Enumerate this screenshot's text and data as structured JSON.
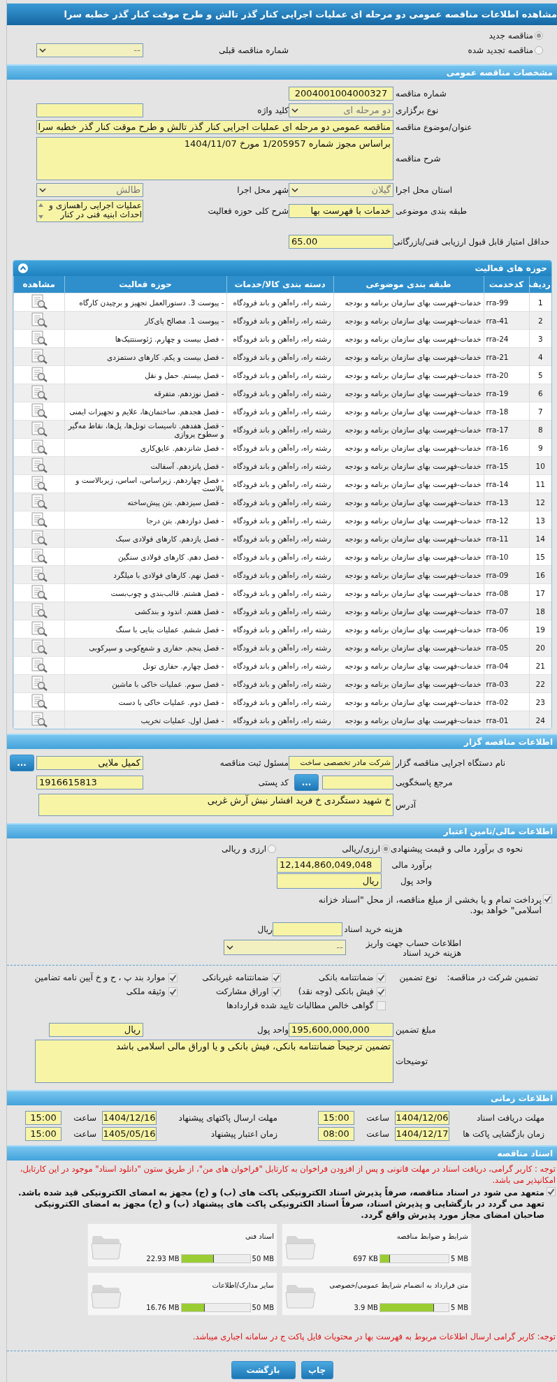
{
  "title": "مشاهده اطلاعات مناقصه عمومی دو مرحله ای عملیات اجرایی کنار گذر تالش و طرح موقت کنار گذر خطبه سرا",
  "tender_type": [
    {
      "label": "مناقصه جدید",
      "selected": true
    },
    {
      "label": "مناقصه تجدید شده",
      "selected": false
    }
  ],
  "previous_tender": {
    "label": "شماره مناقصه قبلی",
    "value": "--"
  },
  "general": {
    "header": "مشخصات مناقصه عمومی",
    "rows": [
      [
        {
          "label": "شماره مناقصه",
          "kind": "number",
          "value": "2004001004000327"
        }
      ],
      [
        {
          "label": "نوع برگزاری",
          "kind": "choice",
          "value": "دو مرحله ای"
        },
        {
          "label": "کلید واژه",
          "kind": "text"
        }
      ],
      [
        {
          "label": "عنوان/موضوع مناقصه",
          "kind": "line",
          "value": "مناقصه عمومی دو مرحله ای عملیات اجرایی کنار گذر تالش و طرح موقت کنار گذر خطبه سرا"
        }
      ],
      [
        {
          "label": "شرح مناقصه",
          "kind": "memo",
          "value": "براساس مجوز شماره 1/205957 مورخ 1404/11/07"
        }
      ],
      [
        {
          "label": "استان محل اجرا",
          "kind": "choice",
          "value": "گیلان"
        },
        {
          "label": "شهر محل اجرا",
          "kind": "choice",
          "value": "طالش"
        }
      ],
      [
        {
          "label": "طبقه بندی موضوعی",
          "kind": "text",
          "value": "خدمات با فهرست بها"
        },
        {
          "label": "شرح کلی حوزه فعالیت",
          "kind": "list",
          "lines": [
            "عملیات اجرایی راهسازی و",
            "احداث ابنیه فنی در  کنار"
          ]
        }
      ]
    ],
    "min_score": {
      "label": "حداقل امتیاز قابل قبول ارزیابی فنی/بازرگانی",
      "value": "65.00"
    }
  },
  "activities": {
    "header": "حوزه های فعالیت",
    "columns": [
      "ردیف",
      "کدخدمت",
      "طبقه بندی موضوعی",
      "دسته بندی کالا/خدمات",
      "حوزه فعالیت",
      "مشاهده"
    ],
    "rows": [
      [
        "1",
        "rra-99",
        "خدمات-فهرست بهای سازمان برنامه و بودجه",
        "رشته راه، راه‌آهن و باند فرودگاه",
        "- پیوست 3. دستورالعمل تجهیز و برچیدن کارگاه"
      ],
      [
        "2",
        "rra-41",
        "خدمات-فهرست بهای سازمان برنامه و بودجه",
        "رشته راه، راه‌آهن و باند فرودگاه",
        "- پیوست 1. مصالح پای‌کار"
      ],
      [
        "3",
        "rra-24",
        "خدمات-فهرست بهای سازمان برنامه و بودجه",
        "رشته راه، راه‌آهن و باند فرودگاه",
        "- فصل بیست و چهارم. ژئوسنتتیک‌ها"
      ],
      [
        "4",
        "rra-21",
        "خدمات-فهرست بهای سازمان برنامه و بودجه",
        "رشته راه، راه‌آهن و باند فرودگاه",
        "- فصل بیست و یکم. کارهای دستمزدی"
      ],
      [
        "5",
        "rra-20",
        "خدمات-فهرست بهای سازمان برنامه و بودجه",
        "رشته راه، راه‌آهن و باند فرودگاه",
        "- فصل بیستم. حمل و نقل"
      ],
      [
        "6",
        "rra-19",
        "خدمات-فهرست بهای سازمان برنامه و بودجه",
        "رشته راه، راه‌آهن و باند فرودگاه",
        "- فصل نوزدهم. متفرقه"
      ],
      [
        "7",
        "rra-18",
        "خدمات-فهرست بهای سازمان برنامه و بودجه",
        "رشته راه، راه‌آهن و باند فرودگاه",
        "- فصل هجدهم. ساختمان‌ها، علایم و تجهیزات ایمنی"
      ],
      [
        "8",
        "rra-17",
        "خدمات-فهرست بهای سازمان برنامه و بودجه",
        "رشته راه، راه‌آهن و باند فرودگاه",
        "- فصل هفدهم. تاسیسات تونل‌ها، پل‌ها، نقاط مه‌گیر و سطوح پروازی"
      ],
      [
        "9",
        "rra-16",
        "خدمات-فهرست بهای سازمان برنامه و بودجه",
        "رشته راه، راه‌آهن و باند فرودگاه",
        "- فصل شانزدهم. عایق‌کاری"
      ],
      [
        "10",
        "rra-15",
        "خدمات-فهرست بهای سازمان برنامه و بودجه",
        "رشته راه، راه‌آهن و باند فرودگاه",
        "- فصل پانزدهم. آسفالت"
      ],
      [
        "11",
        "rra-14",
        "خدمات-فهرست بهای سازمان برنامه و بودجه",
        "رشته راه، راه‌آهن و باند فرودگاه",
        "- فصل چهاردهم. زیراساس، اساس، زیربالاست  و بالاست"
      ],
      [
        "12",
        "rra-13",
        "خدمات-فهرست بهای سازمان برنامه و بودجه",
        "رشته راه، راه‌آهن و باند فرودگاه",
        "- فصل سیزدهم. بتن پیش‌ساخته"
      ],
      [
        "13",
        "rra-12",
        "خدمات-فهرست بهای سازمان برنامه و بودجه",
        "رشته راه، راه‌آهن و باند فرودگاه",
        "- فصل دوازدهم. بتن درجا"
      ],
      [
        "14",
        "rra-11",
        "خدمات-فهرست بهای سازمان برنامه و بودجه",
        "رشته راه، راه‌آهن و باند فرودگاه",
        "- فصل یازدهم. کارهای فولادی سبک"
      ],
      [
        "15",
        "rra-10",
        "خدمات-فهرست بهای سازمان برنامه و بودجه",
        "رشته راه، راه‌آهن و باند فرودگاه",
        "- فصل دهم. کارهای فولادی سنگین"
      ],
      [
        "16",
        "rra-09",
        "خدمات-فهرست بهای سازمان برنامه و بودجه",
        "رشته راه، راه‌آهن و باند فرودگاه",
        "- فصل نهم. کارهای فولادی با میلگرد"
      ],
      [
        "17",
        "rra-08",
        "خدمات-فهرست بهای سازمان برنامه و بودجه",
        "رشته راه، راه‌آهن و باند فرودگاه",
        "- فصل هشتم. قالب‌بندی و چوب‌بست"
      ],
      [
        "18",
        "rra-07",
        "خدمات-فهرست بهای سازمان برنامه و بودجه",
        "رشته راه، راه‌آهن و باند فرودگاه",
        "- فصل هفتم. اندود و بندکشی"
      ],
      [
        "19",
        "rra-06",
        "خدمات-فهرست بهای سازمان برنامه و بودجه",
        "رشته راه، راه‌آهن و باند فرودگاه",
        "- فصل ششم. عملیات بنایی با سنگ"
      ],
      [
        "20",
        "rra-05",
        "خدمات-فهرست بهای سازمان برنامه و بودجه",
        "رشته راه، راه‌آهن و باند فرودگاه",
        "- فصل پنجم. حفاری و شمع‌کوبی و سپرکوبی"
      ],
      [
        "21",
        "rra-04",
        "خدمات-فهرست بهای سازمان برنامه و بودجه",
        "رشته راه، راه‌آهن و باند فرودگاه",
        "- فصل چهارم. حفاری تونل"
      ],
      [
        "22",
        "rra-03",
        "خدمات-فهرست بهای سازمان برنامه و بودجه",
        "رشته راه، راه‌آهن و باند فرودگاه",
        "- فصل سوم. عملیات خاکی با ماشین"
      ],
      [
        "23",
        "rra-02",
        "خدمات-فهرست بهای سازمان برنامه و بودجه",
        "رشته راه، راه‌آهن و باند فرودگاه",
        "- فصل دوم. عملیات خاکی با دست"
      ],
      [
        "24",
        "rra-01",
        "خدمات-فهرست بهای سازمان برنامه و بودجه",
        "رشته راه، راه‌آهن و باند فرودگاه",
        "- فصل اول. عملیات تخریب"
      ]
    ]
  },
  "organizer": {
    "header": "اطلاعات مناقصه گزار",
    "agency": {
      "label": "نام دستگاه اجرایی مناقصه گزار",
      "value": "شرکت مادر تخصصی ساخت"
    },
    "registrar": {
      "label": "مسئول ثبت مناقصه",
      "value": "کمیل ملایی",
      "button": "..."
    },
    "reference": {
      "label": "مرجع پاسخگویی",
      "button": "..."
    },
    "postal_code": {
      "label": "کد پستی",
      "value": "1916615813"
    },
    "address": {
      "label": "آدرس",
      "value": "خ شهید دستگردی خ فرید افشار نبش آرش غربی"
    }
  },
  "finance": {
    "header": "اطلاعات مالی/تامین اعتبار",
    "method": {
      "label": "نحوه ی برآورد مالی و قیمت پیشنهادی",
      "options": [
        {
          "label": "ارزی/ریالی",
          "selected": true
        },
        {
          "label": "ارزی و ریالی",
          "selected": false
        }
      ]
    },
    "estimate": {
      "label": "برآورد مالی",
      "value": "12,144,860,049,048"
    },
    "currency": {
      "label": "واحد پول",
      "value": "ریال"
    },
    "treasury": {
      "label": "پرداخت تمام و یا بخشی از مبلغ مناقصه، از محل \"اسناد خزانه اسلامی\" خواهد بود.",
      "checked": true
    },
    "doc_fee": {
      "label": "هزینه خرید اسناد",
      "unit": "ریال"
    },
    "account": {
      "label": "اطلاعات حساب جهت واریز هزینه خرید اسناد",
      "value": "--"
    }
  },
  "guarantee": {
    "label": "تضمین شرکت در مناقصه:",
    "type_label": "نوع تضمین",
    "options": [
      {
        "label": "ضمانتنامه بانکی",
        "checked": true
      },
      {
        "label": "ضمانتنامه غیربانکی",
        "checked": true
      },
      {
        "label": "موارد بند پ ، ح و خ آیین نامه تضامین",
        "checked": true
      },
      {
        "label": "فیش بانکی (وجه نقد)",
        "checked": true
      },
      {
        "label": "اوراق مشارکت",
        "checked": true
      },
      {
        "label": "وثیقه ملکی",
        "checked": true
      },
      {
        "label": "گواهی خالص مطالبات تایید شده قراردادها",
        "checked": false
      }
    ],
    "amount": {
      "label": "مبلغ تضمین",
      "value": "195,600,000,000"
    },
    "currency": {
      "label": "واحد پول",
      "value": "ریال"
    },
    "notes": {
      "label": "توضیحات",
      "value": "تضمین ترجیحاً ضمانتنامه بانکی، فیش بانکی و یا اوراق مالی اسلامی باشد"
    }
  },
  "timing": {
    "header": "اطلاعات زمانی",
    "items": [
      {
        "label": "مهلت دریافت اسناد",
        "date": "1404/12/06",
        "time_label": "ساعت",
        "time": "15:00"
      },
      {
        "label": "مهلت ارسال پاکتهای پیشنهاد",
        "date": "1404/12/16",
        "time_label": "ساعت",
        "time": "15:00"
      },
      {
        "label": "زمان بازگشایی پاکت ها",
        "date": "1404/12/17",
        "time_label": "ساعت",
        "time": "08:00"
      },
      {
        "label": "زمان اعتبار پیشنهاد",
        "date": "1405/05/16",
        "time_label": "ساعت",
        "time": "15:00"
      }
    ]
  },
  "documents": {
    "header": "اسناد مناقصه",
    "notice": "توجه : کاربر گرامی، دریافت اسناد در مهلت قانونی و پس از افزودن فراخوان به کارتابل \"فراخوان های من\"، از طریق ستون \"دانلود اسناد\" موجود در این کارتابل، امکانپذیر می باشد.",
    "commitment": {
      "text": "متعهد می شود در اسناد مناقصه، صرفاً پذیرش اسناد الکترونیکی پاکت های (ب) و (ج) مجهز به امضای الکترونیکی قید شده باشد. تعهد می گردد در بازگشایی و پذیرش اسناد، صرفاً اسناد الکترونیکی پاکت های پیشنهاد (ب) و (ج) مجهز به امضای الکترونیکی صاحبان امضای مجاز مورد پذیرش واقع گردد.",
      "checked": true
    },
    "files": [
      {
        "title": "شرایط و ضوابط مناقصه",
        "max": "5 MB",
        "used": "697 KB",
        "level": 0.136
      },
      {
        "title": "اسناد فنی",
        "max": "50 MB",
        "used": "22.93 MB",
        "level": 0.459
      },
      {
        "title": "متن قرارداد به انضمام شرایط عمومی/خصوصی",
        "max": "5 MB",
        "used": "3.9 MB",
        "level": 0.78
      },
      {
        "title": "سایر مدارک/اطلاعات",
        "max": "50 MB",
        "used": "16.76 MB",
        "level": 0.335
      }
    ],
    "footnote": "توجه: کاربر گرامی ارسال اطلاعات مربوط به فهرست بها در محتویات فایل پاکت ج در سامانه اجباری میباشد."
  },
  "buttons": [
    {
      "label": "چاپ"
    },
    {
      "label": "بازگشت"
    }
  ]
}
